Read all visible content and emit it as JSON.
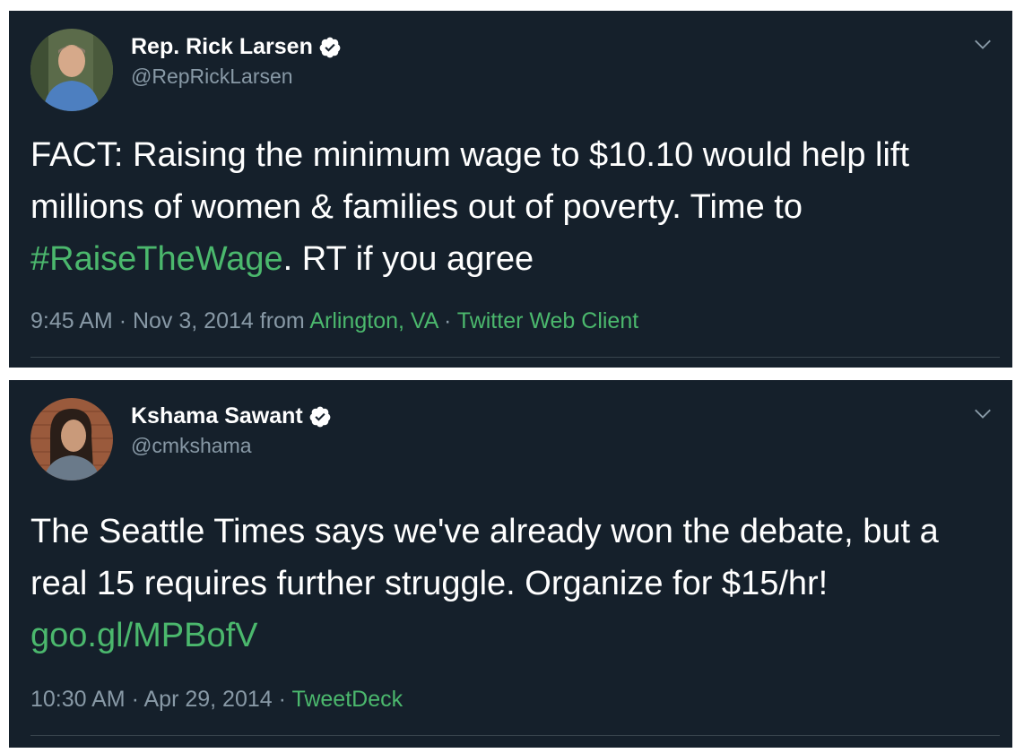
{
  "tweets": [
    {
      "name": "Rep. Rick Larsen",
      "handle": "@RepRickLarsen",
      "text_1": "FACT: Raising the minimum wage to $10.10 would help lift millions of women & families out of poverty. Time to ",
      "hashtag": "#RaiseTheWage",
      "text_2": ". RT if you agree",
      "time": "9:45 AM",
      "date": "Nov 3, 2014",
      "from": "from",
      "location": "Arlington, VA",
      "client": "Twitter Web Client",
      "dot": "·"
    },
    {
      "name": "Kshama Sawant",
      "handle": "@cmkshama",
      "text_1": "The Seattle Times says we've already won the debate, but a real 15 requires further struggle. Organize for $15/hr! ",
      "link": "goo.gl/MPBofV",
      "time": "10:30 AM",
      "date": "Apr 29, 2014",
      "client": "TweetDeck",
      "dot": "·"
    }
  ],
  "colors": {
    "background": "#15202b",
    "text": "#ffffff",
    "muted": "#8899a6",
    "link": "#4bb86d",
    "verified": "#ffffff"
  },
  "icons": [
    "verified-badge-icon",
    "chevron-down-icon"
  ]
}
